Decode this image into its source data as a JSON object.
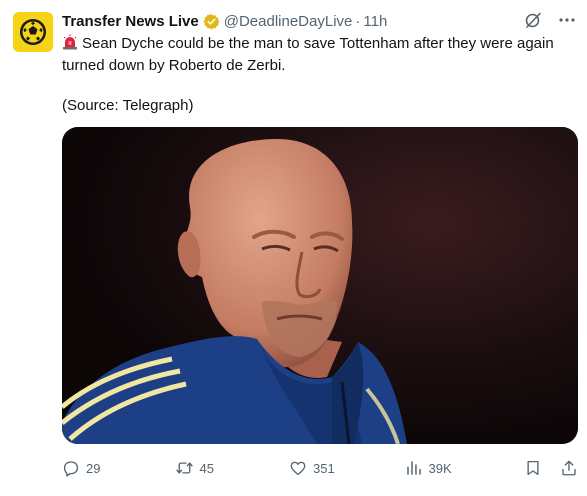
{
  "author": {
    "name": "Transfer News Live",
    "handle": "@DeadlineDayLive",
    "separator": "·",
    "time": "11h",
    "verified_badge_color": "#e2b719",
    "avatar_color": "#f5d416",
    "avatar_icon": "soccer-ball-icon"
  },
  "tweet": {
    "emoji_icon": "police-light-icon",
    "text": "Sean Dyche could be the man to save Tottenham after they were again turned down by Roberto de Zerbi.",
    "source": "(Source: Telegraph)"
  },
  "media": {
    "description_icon": "photo"
  },
  "actions": {
    "reply_count": "29",
    "retweet_count": "45",
    "like_count": "351",
    "views_count": "39K"
  },
  "colors": {
    "text": "#0f1419",
    "secondary": "#536471",
    "accent_stripe": "#f2e6a0",
    "jacket": "#1c3f86"
  }
}
